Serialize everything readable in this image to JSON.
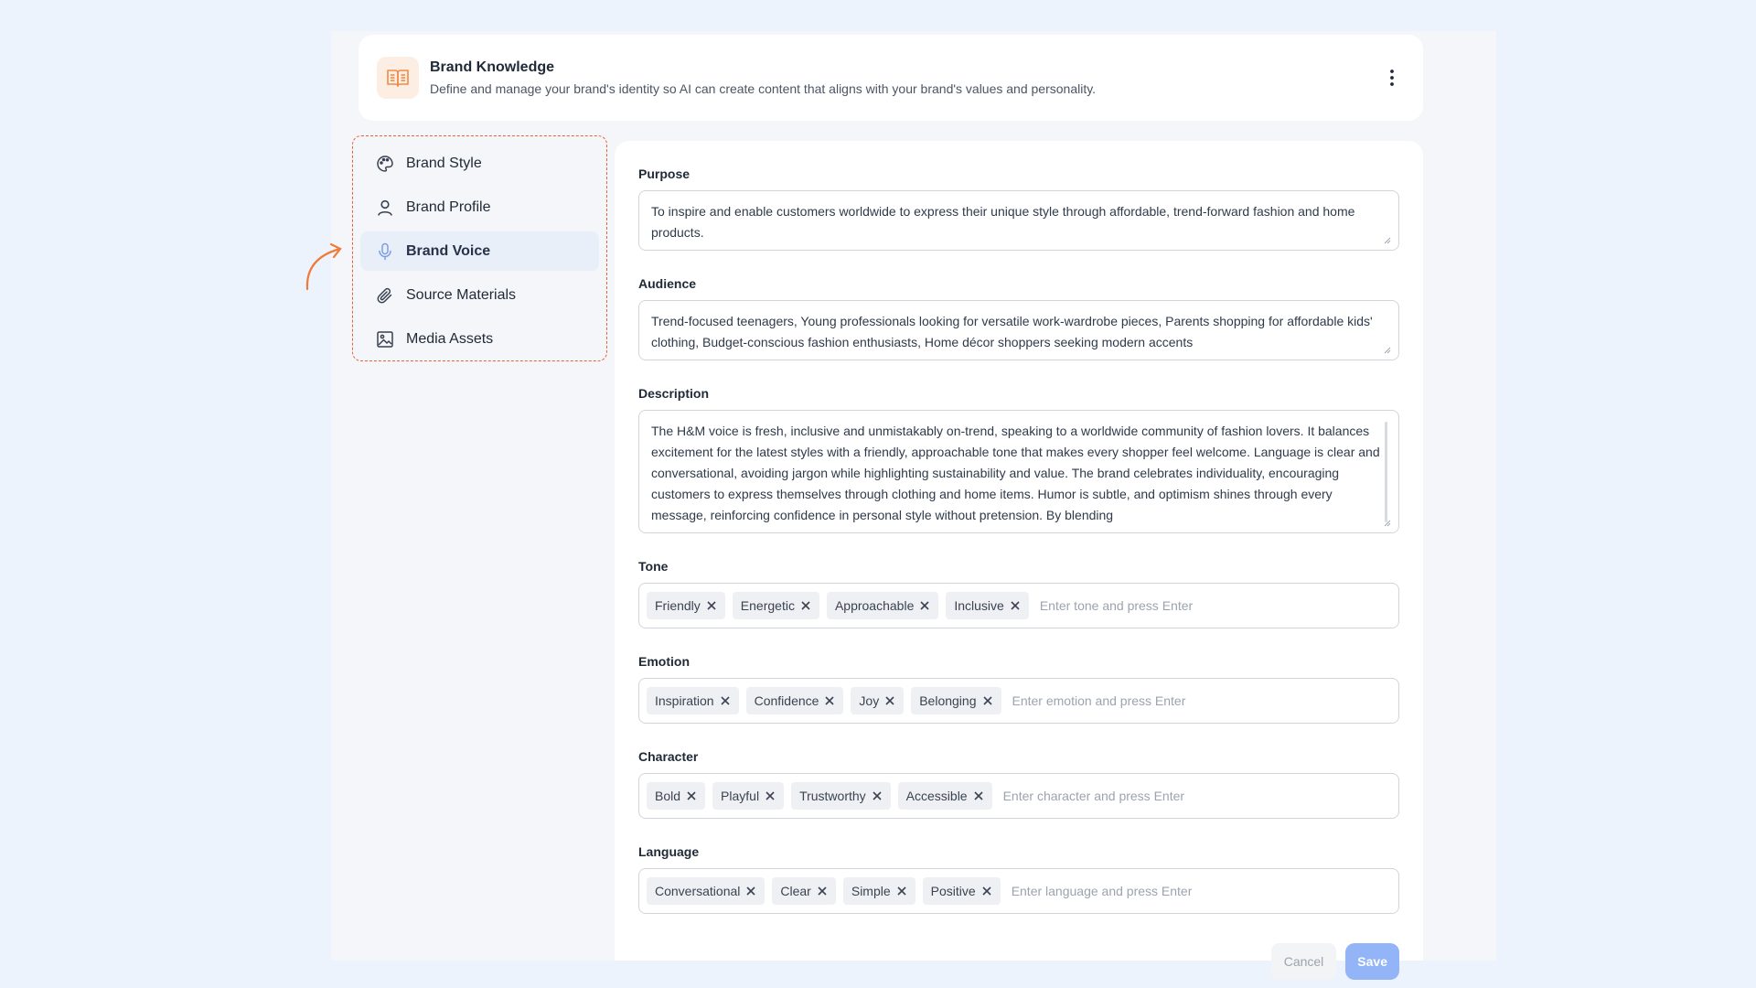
{
  "header": {
    "title": "Brand Knowledge",
    "subtitle": "Define and manage your brand's identity so AI can create content that aligns with your brand's values and personality."
  },
  "sidebar": {
    "items": [
      {
        "label": "Brand Style",
        "icon": "palette-icon"
      },
      {
        "label": "Brand Profile",
        "icon": "user-icon"
      },
      {
        "label": "Brand Voice",
        "icon": "microphone-icon",
        "active": true
      },
      {
        "label": "Source Materials",
        "icon": "paperclip-icon"
      },
      {
        "label": "Media Assets",
        "icon": "image-icon"
      }
    ]
  },
  "form": {
    "purpose": {
      "label": "Purpose",
      "value": "To inspire and enable customers worldwide to express their unique style through affordable, trend-forward fashion and home products."
    },
    "audience": {
      "label": "Audience",
      "value": "Trend-focused teenagers, Young professionals looking for versatile work-wardrobe pieces, Parents shopping for affordable kids' clothing, Budget-conscious fashion enthusiasts, Home décor shoppers seeking modern accents"
    },
    "description": {
      "label": "Description",
      "value": "The H&M voice is fresh, inclusive and unmistakably on-trend, speaking to a worldwide community of fashion lovers. It balances excitement for the latest styles with a friendly, approachable tone that makes every shopper feel welcome. Language is clear and conversational, avoiding jargon while highlighting sustainability and value. The brand celebrates individuality, encouraging customers to express themselves through clothing and home items. Humor is subtle, and optimism shines through every message, reinforcing confidence in personal style without pretension. By blending"
    },
    "tone": {
      "label": "Tone",
      "tags": [
        "Friendly",
        "Energetic",
        "Approachable",
        "Inclusive"
      ],
      "placeholder": "Enter tone and press Enter"
    },
    "emotion": {
      "label": "Emotion",
      "tags": [
        "Inspiration",
        "Confidence",
        "Joy",
        "Belonging"
      ],
      "placeholder": "Enter emotion and press Enter"
    },
    "character": {
      "label": "Character",
      "tags": [
        "Bold",
        "Playful",
        "Trustworthy",
        "Accessible"
      ],
      "placeholder": "Enter character and press Enter"
    },
    "language": {
      "label": "Language",
      "tags": [
        "Conversational",
        "Clear",
        "Simple",
        "Positive"
      ],
      "placeholder": "Enter language and press Enter"
    },
    "cancel_label": "Cancel",
    "save_label": "Save"
  },
  "colors": {
    "accent": "#e8613a",
    "save_button": "#93b4f7",
    "active_nav": "#e9eff8"
  }
}
